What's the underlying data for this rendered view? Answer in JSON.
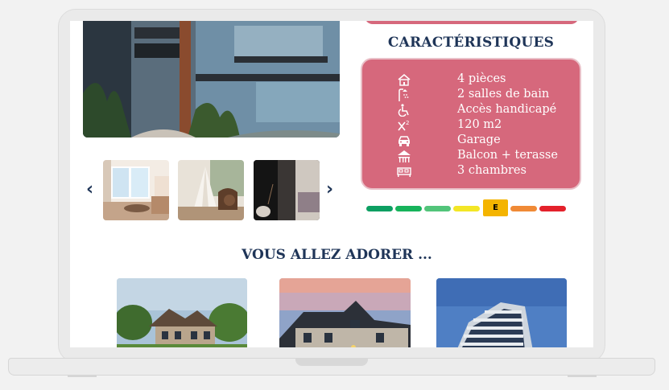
{
  "characteristics": {
    "title": "CARACTÉRISTIQUES",
    "items": [
      {
        "icon": "house-icon",
        "label": "4 pièces"
      },
      {
        "icon": "shower-icon",
        "label": "2 salles de bain"
      },
      {
        "icon": "wheelchair-icon",
        "label": "Accès handicapé"
      },
      {
        "icon": "area-icon",
        "label": "120 m2"
      },
      {
        "icon": "car-icon",
        "label": "Garage"
      },
      {
        "icon": "balcony-icon",
        "label": "Balcon + terasse"
      },
      {
        "icon": "bed-icon",
        "label": "3 chambres"
      }
    ]
  },
  "energy": {
    "selected_label": "E",
    "colors": [
      "#0d9f62",
      "#17b35b",
      "#52c47a",
      "#f3e626",
      "#f4b400",
      "#f08a36",
      "#e4212b"
    ]
  },
  "recommendations": {
    "title": "VOUS ALLEZ ADORER ..."
  }
}
